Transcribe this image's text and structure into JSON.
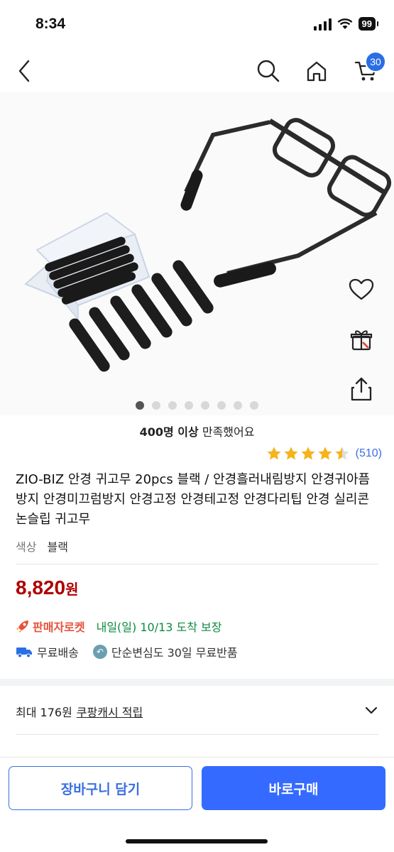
{
  "status_bar": {
    "time": "8:34",
    "battery": "99"
  },
  "nav": {
    "cart_count": "30",
    "icons": [
      "back-icon",
      "search-icon",
      "home-icon",
      "cart-icon"
    ]
  },
  "side_actions": [
    "heart-icon",
    "gift-icon",
    "share-icon"
  ],
  "image_carousel": {
    "total": 8,
    "current": 1
  },
  "satisfaction": {
    "count": "400명 이상",
    "text": "만족했어요"
  },
  "rating": {
    "stars": 4.5,
    "count": "(510)"
  },
  "product": {
    "title": "ZIO-BIZ 안경 귀고무 20pcs 블랙 / 안경흘러내림방지 안경귀아픔방지 안경미끄럼방지 안경고정 안경테고정 안경다리팁 안경 실리콘 논슬립 귀고무",
    "option_label": "색상",
    "option_value": "블랙",
    "price": "8,820",
    "price_unit": "원"
  },
  "delivery": {
    "badge": "판매자로켓",
    "text": "내일(일) 10/13 도착 보장"
  },
  "shipping": {
    "free_shipping": "무료배송",
    "returns": "단순변심도 30일 무료반품"
  },
  "cashback": {
    "prefix": "최대 176원",
    "link": "쿠팡캐시 적립"
  },
  "colors": {
    "accent": "#346aff",
    "price": "#ae0000",
    "rocket": "#e8503a",
    "delivery": "#0b8a3e",
    "star": "#f5b41a"
  },
  "buttons": {
    "add_to_cart": "장바구니 담기",
    "buy_now": "바로구매"
  }
}
